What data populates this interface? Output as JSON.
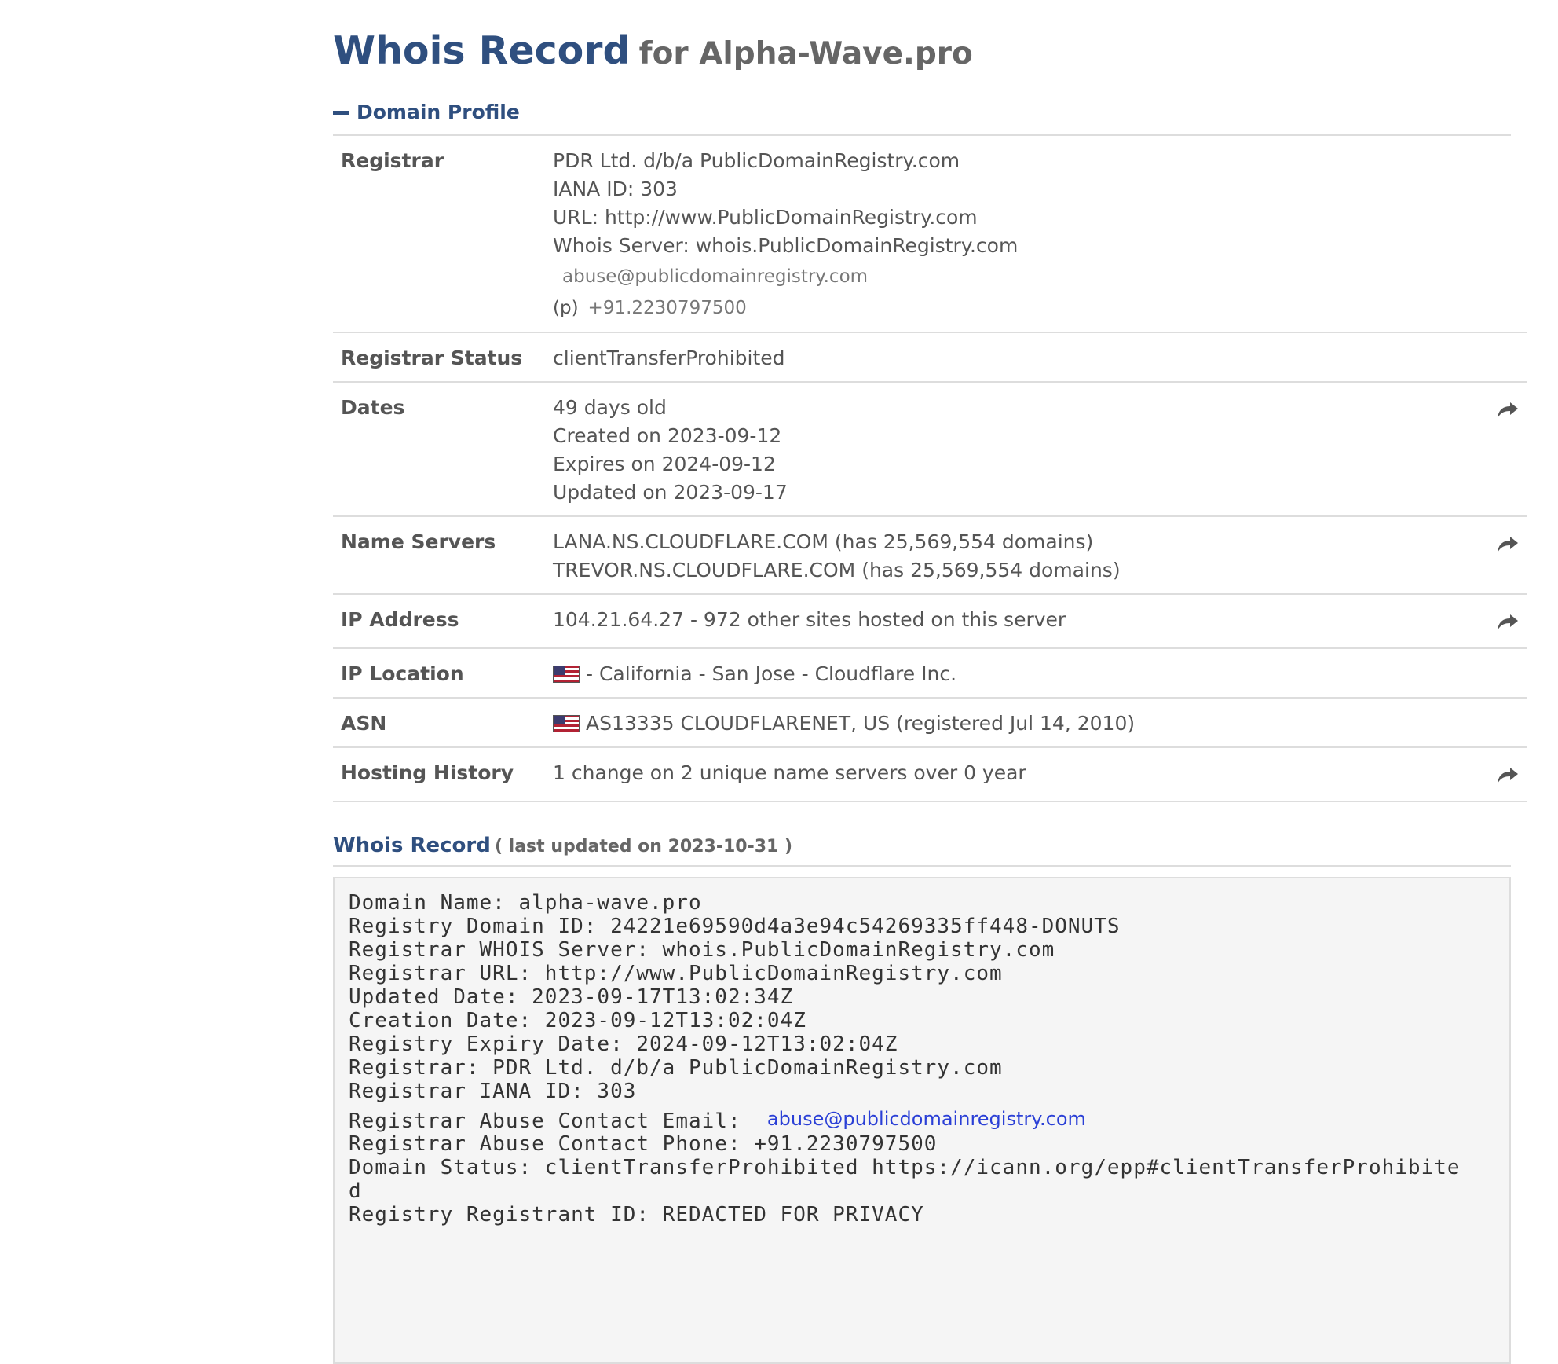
{
  "header": {
    "title_main": "Whois Record",
    "title_sub": "for Alpha-Wave.pro"
  },
  "domain_profile": {
    "section_title": "Domain Profile",
    "rows": {
      "registrar": {
        "label": "Registrar",
        "name": "PDR Ltd. d/b/a PublicDomainRegistry.com",
        "iana": "IANA ID: 303",
        "url": "URL: http://www.PublicDomainRegistry.com",
        "whois_server": "Whois Server: whois.PublicDomainRegistry.com",
        "email": "abuse@publicdomainregistry.com",
        "phone_prefix": "(p)",
        "phone": "+91.2230797500"
      },
      "registrar_status": {
        "label": "Registrar Status",
        "value": "clientTransferProhibited"
      },
      "dates": {
        "label": "Dates",
        "age": "49 days old",
        "created": "Created on 2023-09-12",
        "expires": "Expires on 2024-09-12",
        "updated": "Updated on 2023-09-17",
        "action_icon": "share-arrow-icon"
      },
      "name_servers": {
        "label": "Name Servers",
        "ns1": "LANA.NS.CLOUDFLARE.COM (has 25,569,554 domains)",
        "ns2": "TREVOR.NS.CLOUDFLARE.COM (has 25,569,554 domains)",
        "action_icon": "share-arrow-icon"
      },
      "ip_address": {
        "label": "IP Address",
        "value": "104.21.64.27 - 972 other sites hosted on this server",
        "action_icon": "share-arrow-icon"
      },
      "ip_location": {
        "label": "IP Location",
        "flag_icon": "us-flag-icon",
        "value": "- California - San Jose - Cloudflare Inc."
      },
      "asn": {
        "label": "ASN",
        "flag_icon": "us-flag-icon",
        "value": "AS13335 CLOUDFLARENET, US (registered Jul 14, 2010)"
      },
      "hosting_history": {
        "label": "Hosting History",
        "value": "1 change on 2 unique name servers over 0 year",
        "action_icon": "share-arrow-icon"
      }
    }
  },
  "whois_record": {
    "title": "Whois Record",
    "updated": "( last updated on 2023-10-31 )",
    "lines": {
      "domain_name": "Domain Name: alpha-wave.pro",
      "registry_domain_id": "Registry Domain ID: 24221e69590d4a3e94c54269335ff448-DONUTS",
      "registrar_whois_server": "Registrar WHOIS Server: whois.PublicDomainRegistry.com",
      "registrar_url": "Registrar URL: http://www.PublicDomainRegistry.com",
      "updated_date": "Updated Date: 2023-09-17T13:02:34Z",
      "creation_date": "Creation Date: 2023-09-12T13:02:04Z",
      "expiry_date": "Registry Expiry Date: 2024-09-12T13:02:04Z",
      "registrar": "Registrar: PDR Ltd. d/b/a PublicDomainRegistry.com",
      "registrar_iana": "Registrar IANA ID: 303",
      "abuse_email_label": "Registrar Abuse Contact Email:",
      "abuse_email": "abuse@publicdomainregistry.com",
      "abuse_phone": "Registrar Abuse Contact Phone: +91.2230797500",
      "domain_status": "Domain Status: clientTransferProhibited https://icann.org/epp#clientTransferProhibite",
      "domain_status_wrap": "d",
      "registrant_id_partial": "Registry Registrant ID: REDACTED FOR PRIVACY"
    }
  },
  "colors": {
    "brand_blue": "#2f4f7f",
    "link_blue": "#2a3fd6",
    "row_border": "#dddddd",
    "raw_background": "#f5f5f5"
  }
}
